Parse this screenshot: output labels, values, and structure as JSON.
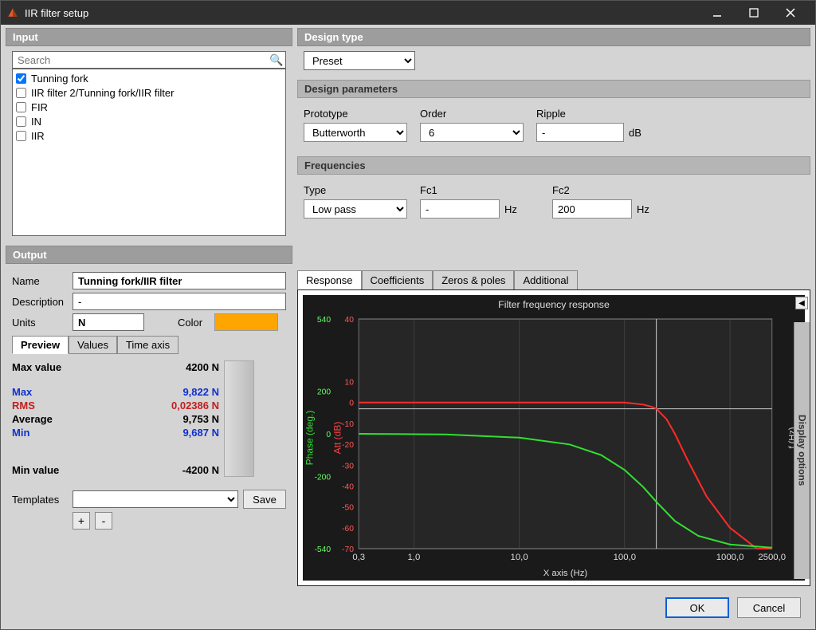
{
  "window": {
    "title": "IIR filter setup"
  },
  "input_panel": {
    "title": "Input",
    "search_placeholder": "Search",
    "items": [
      {
        "label": "Tunning fork",
        "checked": true
      },
      {
        "label": "IIR filter 2/Tunning fork/IIR filter",
        "checked": false
      },
      {
        "label": "FIR",
        "checked": false
      },
      {
        "label": "IN",
        "checked": false
      },
      {
        "label": "IIR",
        "checked": false
      }
    ]
  },
  "output_panel": {
    "title": "Output",
    "fields": {
      "name_label": "Name",
      "name": "Tunning fork/IIR filter",
      "desc_label": "Description",
      "desc": "-",
      "units_label": "Units",
      "units": "N",
      "color_label": "Color",
      "color": "#ffa500"
    },
    "subtabs": {
      "preview": "Preview",
      "values": "Values",
      "time_axis": "Time axis"
    },
    "stats": {
      "max_value_label": "Max value",
      "max_value": "4200 N",
      "max_label": "Max",
      "max": "9,822 N",
      "rms_label": "RMS",
      "rms": "0,02386 N",
      "avg_label": "Average",
      "avg": "9,753 N",
      "min_label": "Min",
      "min": "9,687 N",
      "min_value_label": "Min value",
      "min_value": "-4200 N"
    },
    "templates": {
      "label": "Templates",
      "save": "Save",
      "add": "+",
      "remove": "-"
    }
  },
  "design_type": {
    "title": "Design type",
    "value": "Preset"
  },
  "design_params": {
    "title": "Design parameters",
    "prototype_label": "Prototype",
    "prototype": "Butterworth",
    "order_label": "Order",
    "order": "6",
    "ripple_label": "Ripple",
    "ripple": "-",
    "ripple_unit": "dB"
  },
  "frequencies": {
    "title": "Frequencies",
    "type_label": "Type",
    "type": "Low pass",
    "fc1_label": "Fc1",
    "fc1": "-",
    "fc1_unit": "Hz",
    "fc2_label": "Fc2",
    "fc2": "200",
    "fc2_unit": "Hz"
  },
  "plot_tabs": {
    "response": "Response",
    "coeff": "Coefficients",
    "zeros": "Zeros & poles",
    "additional": "Additional"
  },
  "footer": {
    "ok": "OK",
    "cancel": "Cancel"
  },
  "display_options": "Display options",
  "chart_data": {
    "type": "line",
    "title": "Filter frequency response",
    "xlabel": "X axis (Hz)",
    "ylabel_left": "Phase (deg.)",
    "ylabel_right": "Att (dB)",
    "far_right_label": "f (Hz)",
    "x_log": true,
    "x_ticks": [
      0.3,
      1.0,
      10.0,
      100.0,
      1000.0,
      2500.0
    ],
    "x_tick_labels": [
      "0,3",
      "1,0",
      "10,0",
      "100,0",
      "1000,0",
      "2500,0"
    ],
    "xlim": [
      0.3,
      2500.0
    ],
    "phase_ticks": [
      -540,
      -200,
      0,
      200,
      540
    ],
    "phase_lim": [
      -540,
      540
    ],
    "att_ticks": [
      -70,
      -60,
      -50,
      -40,
      -30,
      -20,
      -10,
      0,
      10,
      40
    ],
    "att_lim": [
      -70,
      40
    ],
    "series": [
      {
        "name": "Attenuation (dB)",
        "axis": "att",
        "color": "#ff2a2a",
        "points": [
          {
            "x": 0.3,
            "y": 0
          },
          {
            "x": 50,
            "y": 0
          },
          {
            "x": 100,
            "y": 0
          },
          {
            "x": 150,
            "y": -1
          },
          {
            "x": 180,
            "y": -2
          },
          {
            "x": 200,
            "y": -3
          },
          {
            "x": 250,
            "y": -8
          },
          {
            "x": 300,
            "y": -15
          },
          {
            "x": 400,
            "y": -28
          },
          {
            "x": 600,
            "y": -45
          },
          {
            "x": 1000,
            "y": -60
          },
          {
            "x": 1800,
            "y": -70
          },
          {
            "x": 2500,
            "y": -70
          }
        ]
      },
      {
        "name": "Phase (deg.)",
        "axis": "phase",
        "color": "#30e030",
        "points": [
          {
            "x": 0.3,
            "y": 0
          },
          {
            "x": 2,
            "y": -3
          },
          {
            "x": 10,
            "y": -18
          },
          {
            "x": 30,
            "y": -50
          },
          {
            "x": 60,
            "y": -100
          },
          {
            "x": 100,
            "y": -170
          },
          {
            "x": 150,
            "y": -250
          },
          {
            "x": 200,
            "y": -320
          },
          {
            "x": 300,
            "y": -410
          },
          {
            "x": 500,
            "y": -480
          },
          {
            "x": 1000,
            "y": -520
          },
          {
            "x": 2500,
            "y": -535
          }
        ]
      }
    ],
    "cursor_x": 200
  }
}
